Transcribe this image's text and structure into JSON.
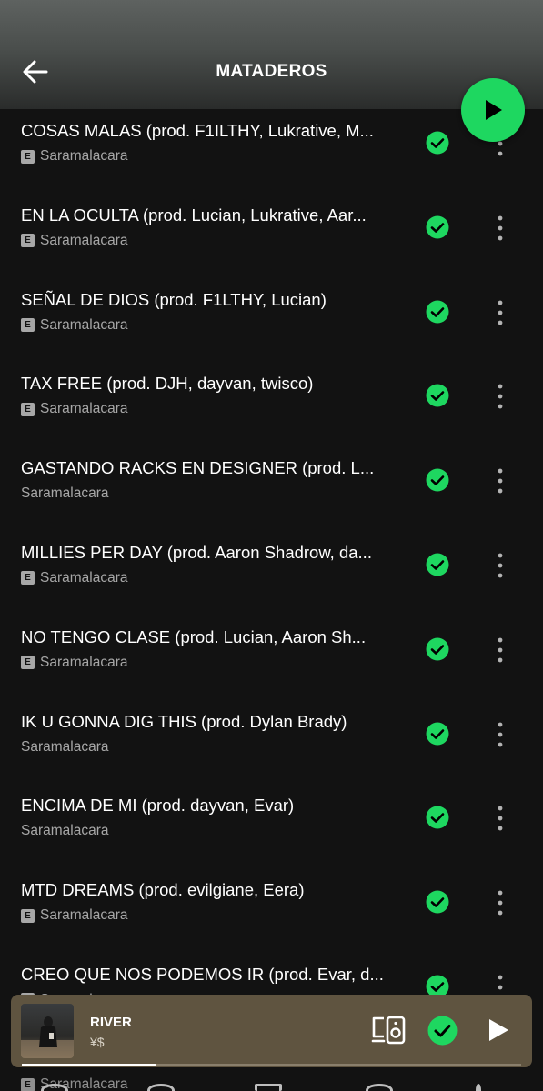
{
  "header": {
    "title": "MATADEROS",
    "back_icon": "arrow-left-icon",
    "play_icon": "play-icon",
    "accent": "#1ed760"
  },
  "tracks": [
    {
      "title": "COSAS MALAS (prod. F1ILTHY, Lukrative, M...",
      "artist": "Saramalacara",
      "explicit": true
    },
    {
      "title": "EN LA OCULTA (prod. Lucian, Lukrative, Aar...",
      "artist": "Saramalacara",
      "explicit": true
    },
    {
      "title": "SEÑAL DE DIOS (prod. F1LTHY, Lucian)",
      "artist": "Saramalacara",
      "explicit": true
    },
    {
      "title": "TAX FREE (prod. DJH, dayvan, twisco)",
      "artist": "Saramalacara",
      "explicit": true
    },
    {
      "title": "GASTANDO RACKS EN DESIGNER (prod. L...",
      "artist": "Saramalacara",
      "explicit": false
    },
    {
      "title": "MILLIES PER DAY (prod. Aaron Shadrow, da...",
      "artist": "Saramalacara",
      "explicit": true
    },
    {
      "title": "NO TENGO CLASE (prod. Lucian, Aaron Sh...",
      "artist": "Saramalacara",
      "explicit": true
    },
    {
      "title": "IK U GONNA DIG THIS (prod. Dylan Brady)",
      "artist": "Saramalacara",
      "explicit": false
    },
    {
      "title": "ENCIMA DE MI (prod. dayvan, Evar)",
      "artist": "Saramalacara",
      "explicit": false
    },
    {
      "title": "MTD DREAMS (prod. evilgiane, Eera)",
      "artist": "Saramalacara",
      "explicit": true
    },
    {
      "title": "CREO QUE NOS PODEMOS IR (prod. Evar, d...",
      "artist": "Saramalacara",
      "explicit": true
    }
  ],
  "explicit_label": "E",
  "downloaded_icon": "downloaded-check-icon",
  "more_icon": "more-vertical-icon",
  "mini_player": {
    "title": "RIVER",
    "artist": "¥$",
    "device_icon": "devices-icon",
    "saved_icon": "check-circle-icon",
    "play_icon": "play-icon",
    "background": "#5f5440",
    "progress": 0.27
  },
  "bottom_peek": {
    "artist": "Saramalacara"
  }
}
